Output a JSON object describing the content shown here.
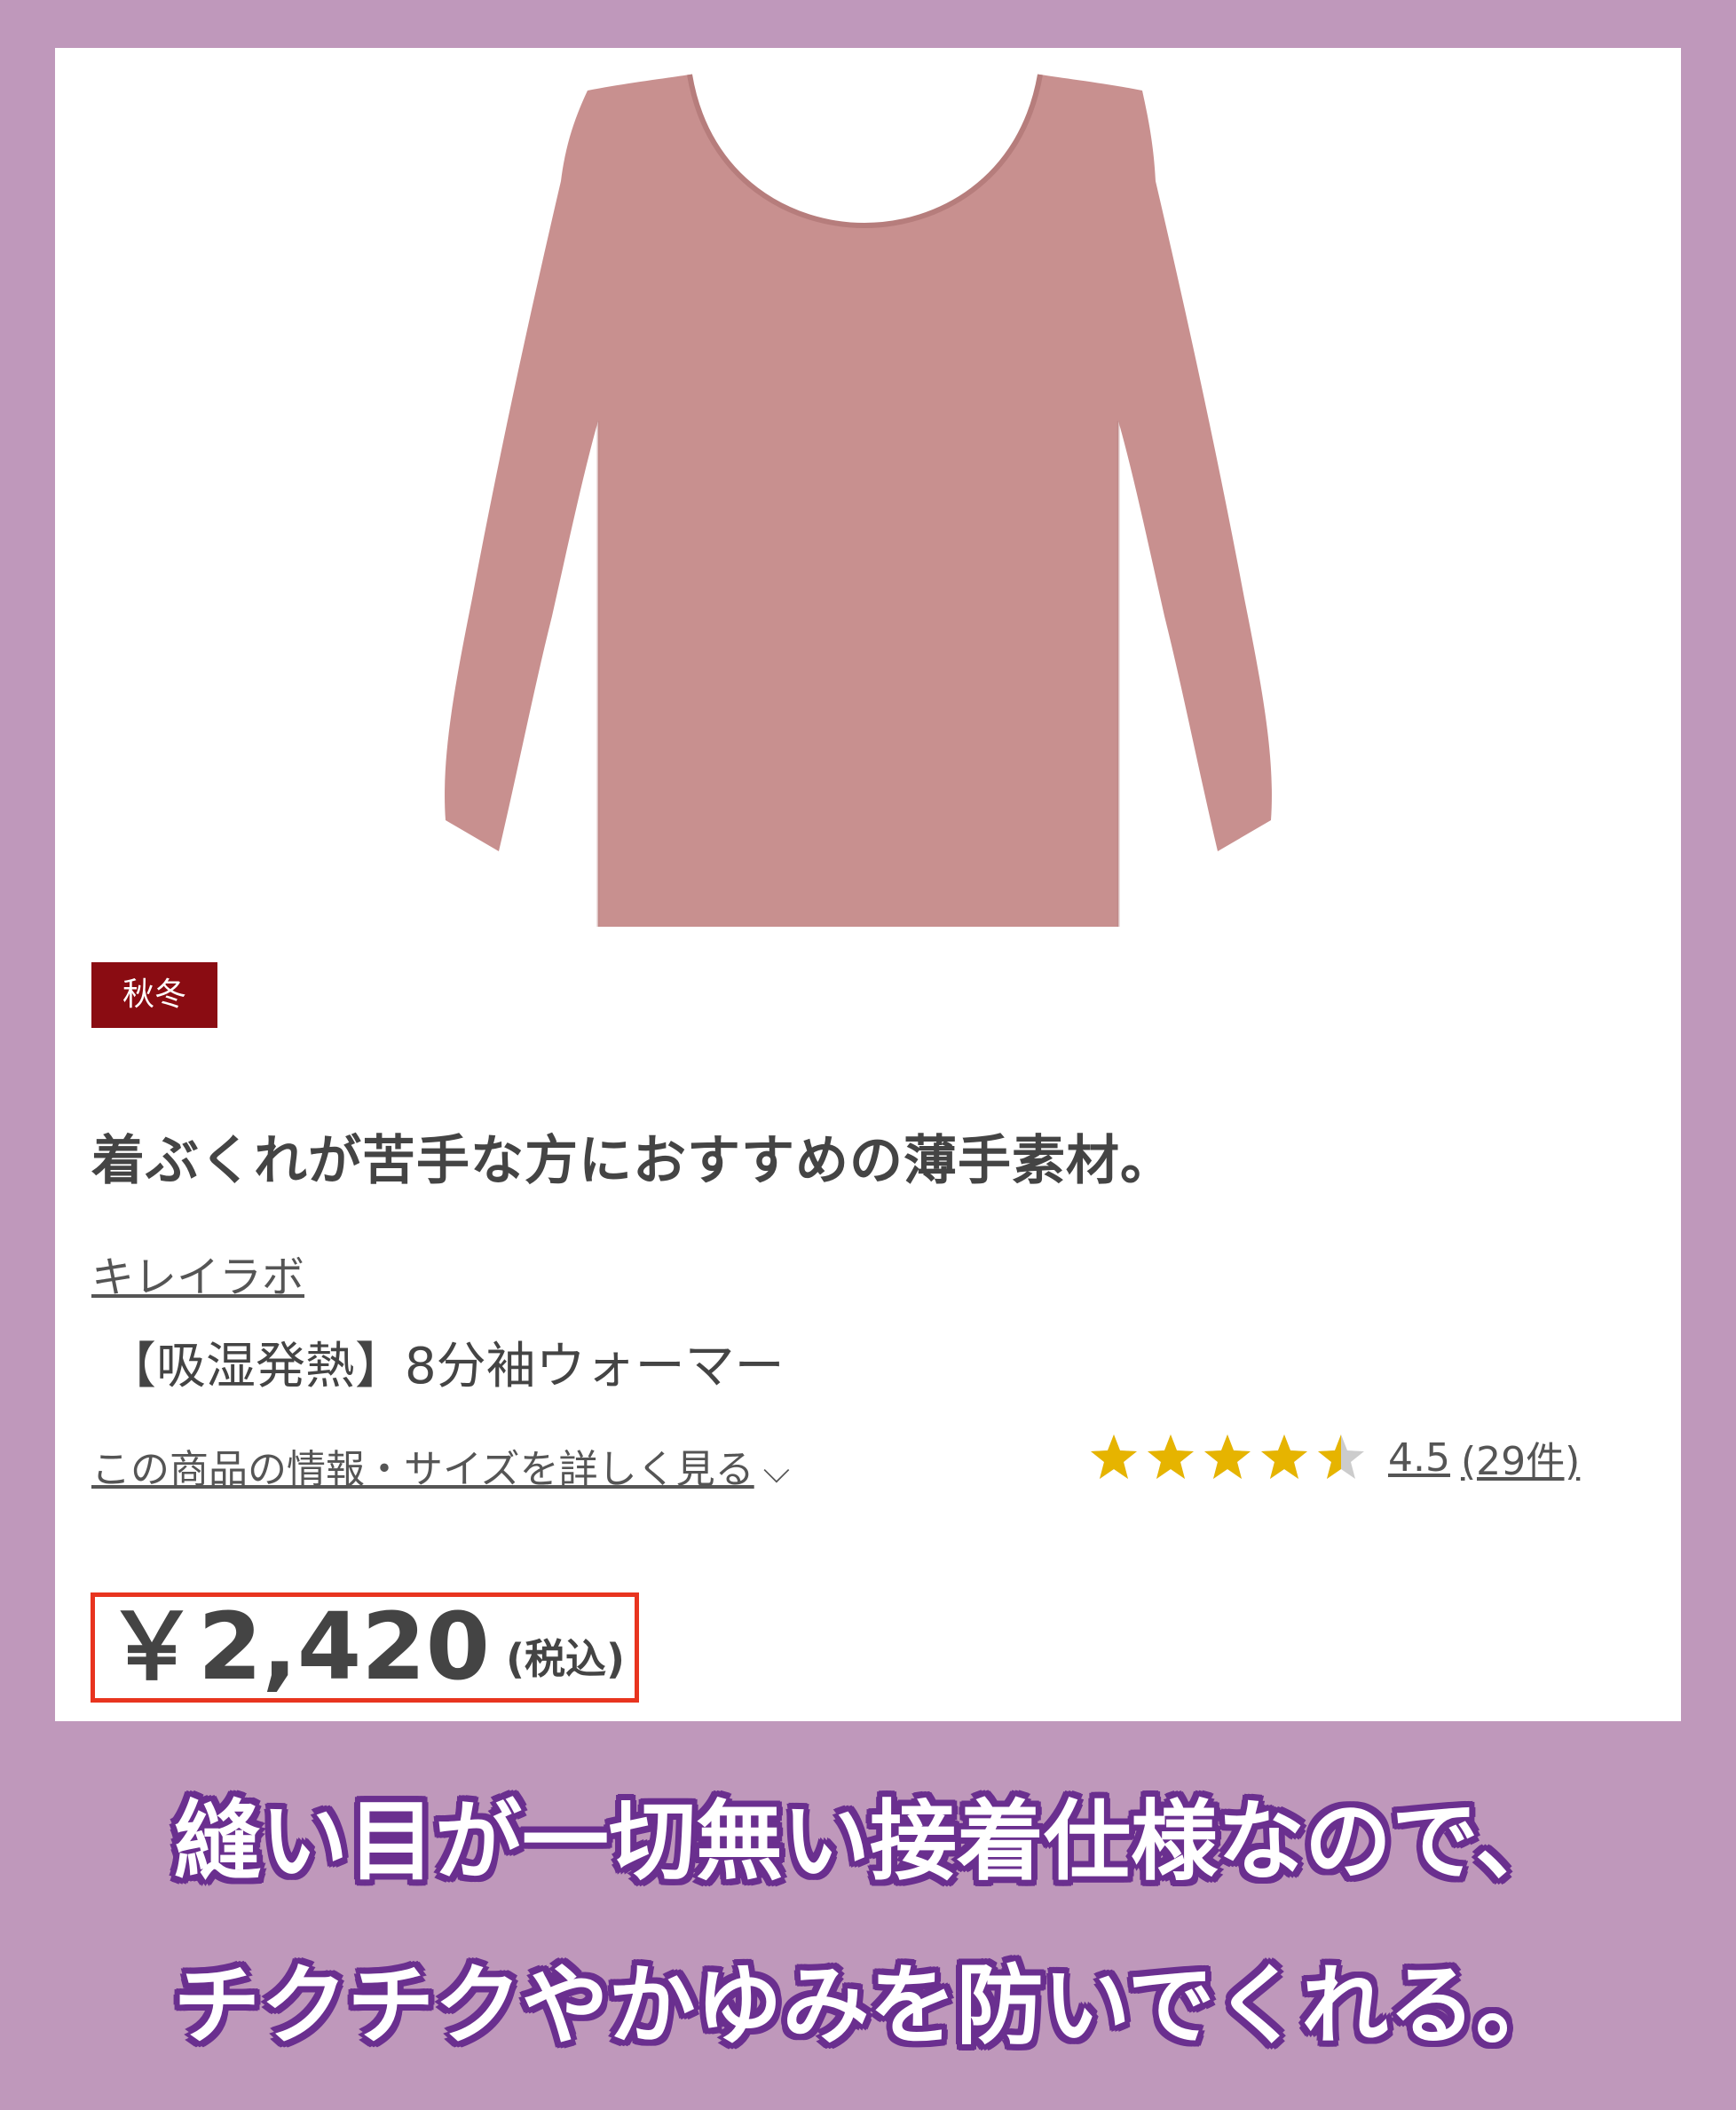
{
  "product": {
    "image_icon": "long-sleeve-top-image",
    "garment_color": "#c8908f",
    "season_badge": "秋冬",
    "catch_copy": "着ぶくれが苦手な方におすすめの薄手素材。",
    "brand": "キレイラボ",
    "name": "【吸湿発熱】8分袖ウォーマー",
    "details_link": "この商品の情報・サイズを詳しく見る",
    "details_icon": "chevron-down-icon",
    "rating": {
      "stars": 4.5,
      "max_stars": 5,
      "value": "4.5",
      "count": "(29件)",
      "star_color": "#e6b400",
      "empty_star_color": "#cccccc"
    },
    "price": "￥2,420",
    "tax_note": "(税込)",
    "price_highlight_color": "#e8341f"
  },
  "captions": {
    "line1": "縫い目が一切無い接着仕様なので、",
    "line2": "チクチクやかゆみを防いでくれる。"
  },
  "colors": {
    "background": "#bf98bb",
    "caption_outline": "#6a2f8f",
    "badge": "#8a0c12"
  }
}
